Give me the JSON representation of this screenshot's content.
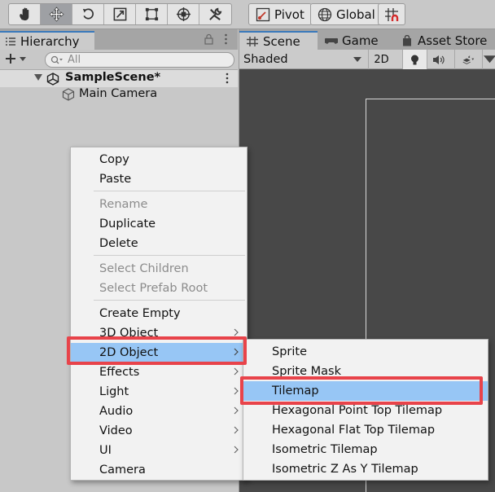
{
  "toolbar": {
    "tools": [
      {
        "name": "hand-tool-icon"
      },
      {
        "name": "move-tool-icon"
      },
      {
        "name": "rotate-tool-icon"
      },
      {
        "name": "scale-tool-icon"
      },
      {
        "name": "rect-tool-icon"
      },
      {
        "name": "transform-tool-icon"
      },
      {
        "name": "custom-tool-icon"
      }
    ],
    "pivot_label": "Pivot",
    "global_label": "Global"
  },
  "hierarchy": {
    "tab_label": "Hierarchy",
    "search_placeholder": "All",
    "scene_name": "SampleScene*",
    "objects": [
      "Main Camera"
    ]
  },
  "scene_panel": {
    "tabs": [
      "Scene",
      "Game",
      "Asset Store"
    ],
    "shading_mode": "Shaded",
    "mode_2d_label": "2D"
  },
  "context_menu": {
    "items": [
      {
        "label": "Copy",
        "enabled": true
      },
      {
        "label": "Paste",
        "enabled": true
      },
      {
        "label": "Rename",
        "enabled": false
      },
      {
        "label": "Duplicate",
        "enabled": true
      },
      {
        "label": "Delete",
        "enabled": true
      },
      {
        "label": "Select Children",
        "enabled": false
      },
      {
        "label": "Select Prefab Root",
        "enabled": false
      },
      {
        "label": "Create Empty",
        "enabled": true
      },
      {
        "label": "3D Object",
        "enabled": true,
        "submenu": true
      },
      {
        "label": "2D Object",
        "enabled": true,
        "submenu": true,
        "highlighted": true
      },
      {
        "label": "Effects",
        "enabled": true,
        "submenu": true
      },
      {
        "label": "Light",
        "enabled": true,
        "submenu": true
      },
      {
        "label": "Audio",
        "enabled": true,
        "submenu": true
      },
      {
        "label": "Video",
        "enabled": true,
        "submenu": true
      },
      {
        "label": "UI",
        "enabled": true,
        "submenu": true
      },
      {
        "label": "Camera",
        "enabled": true
      }
    ]
  },
  "submenu_2d": {
    "items": [
      {
        "label": "Sprite"
      },
      {
        "label": "Sprite Mask"
      },
      {
        "label": "Tilemap",
        "highlighted": true
      },
      {
        "label": "Hexagonal Point Top Tilemap"
      },
      {
        "label": "Hexagonal Flat Top Tilemap"
      },
      {
        "label": "Isometric Tilemap"
      },
      {
        "label": "Isometric Z As Y Tilemap"
      }
    ]
  },
  "colors": {
    "highlight": "#97c6f5",
    "callout_red": "#e8434a",
    "tab_accent": "#3a79bb",
    "scene_bg": "#484848"
  }
}
